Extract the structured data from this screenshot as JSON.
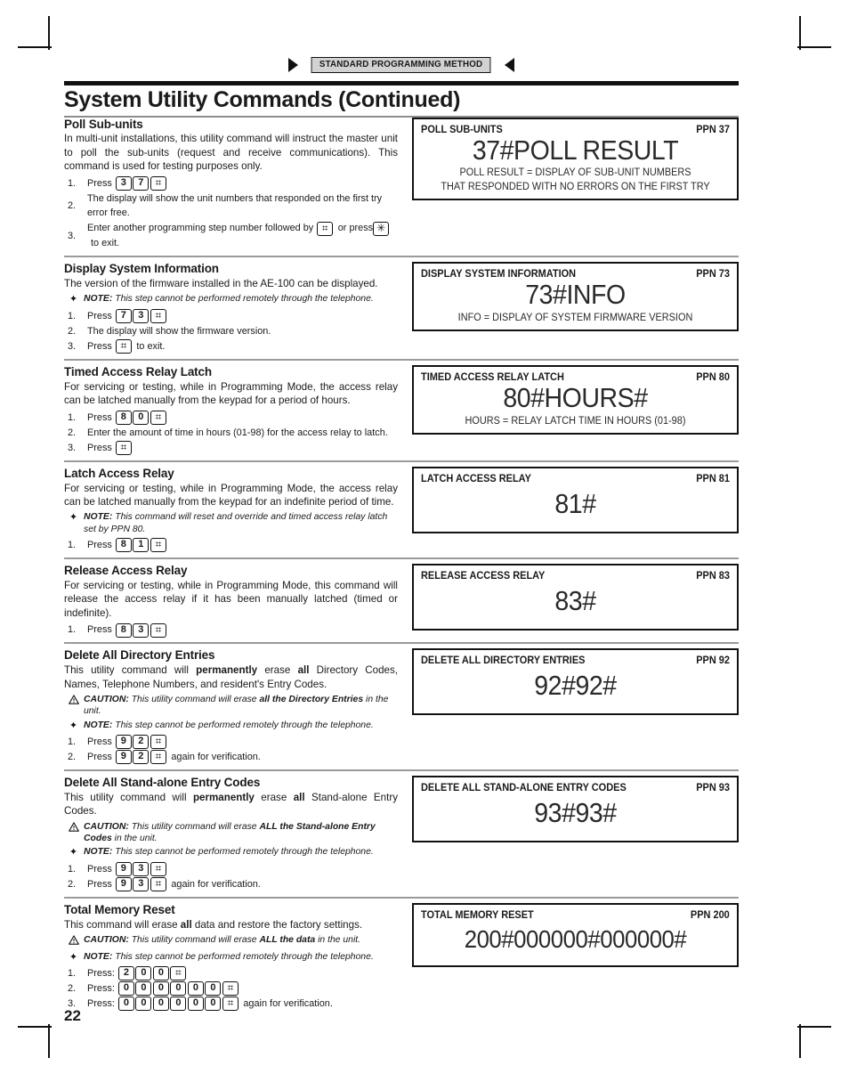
{
  "header": {
    "badge": "STANDARD PROGRAMMING METHOD",
    "arrow_left_icon": "triangle-right-icon",
    "arrow_right_icon": "triangle-left-icon",
    "title": "System Utility Commands (Continued)"
  },
  "page_number": "22",
  "sections": [
    {
      "heading": "Poll Sub-units",
      "body": "In multi-unit installations, this utility command will instruct the master unit to poll the sub-units (request and receive communications). This command is used for testing purposes only.",
      "admonitions": [],
      "steps": [
        {
          "n": "1.",
          "parts": [
            {
              "t": "text",
              "v": "Press"
            },
            {
              "t": "key",
              "v": "3"
            },
            {
              "t": "key",
              "v": "7"
            },
            {
              "t": "key",
              "v": "#"
            }
          ]
        },
        {
          "n": "2.",
          "parts": [
            {
              "t": "text",
              "v": "The display will show the unit numbers that responded on the first try error free."
            }
          ]
        },
        {
          "n": "3.",
          "parts": [
            {
              "t": "text",
              "v": "Enter another programming step number followed by"
            },
            {
              "t": "key",
              "v": "#"
            },
            {
              "t": "text",
              "v": "or press"
            },
            {
              "t": "key",
              "v": "*"
            },
            {
              "t": "text",
              "v": "to exit."
            }
          ]
        }
      ],
      "panel": {
        "title": "POLL SUB-UNITS",
        "ppn": "PPN 37",
        "command": "37#POLL RESULT",
        "captions": [
          "POLL RESULT = DISPLAY OF SUB-UNIT NUMBERS",
          "THAT RESPONDED WITH NO ERRORS ON THE FIRST TRY"
        ]
      }
    },
    {
      "heading": "Display System Information",
      "body": "The version of the firmware installed in the AE-100 can be displayed.",
      "admonitions": [
        {
          "kind": "note",
          "label": "NOTE:",
          "parts": [
            {
              "t": "text",
              "v": "This step cannot be performed remotely through the telephone."
            }
          ]
        }
      ],
      "steps": [
        {
          "n": "1.",
          "parts": [
            {
              "t": "text",
              "v": "Press"
            },
            {
              "t": "key",
              "v": "7"
            },
            {
              "t": "key",
              "v": "3"
            },
            {
              "t": "key",
              "v": "#"
            }
          ]
        },
        {
          "n": "2.",
          "parts": [
            {
              "t": "text",
              "v": "The display will show the firmware version."
            }
          ]
        },
        {
          "n": "3.",
          "parts": [
            {
              "t": "text",
              "v": "Press"
            },
            {
              "t": "key",
              "v": "#"
            },
            {
              "t": "text",
              "v": "to exit."
            }
          ]
        }
      ],
      "panel": {
        "title": "DISPLAY SYSTEM INFORMATION",
        "ppn": "PPN 73",
        "command": "73#INFO",
        "captions": [
          "INFO = DISPLAY OF SYSTEM FIRMWARE VERSION"
        ]
      }
    },
    {
      "heading": "Timed Access Relay Latch",
      "body": "For servicing or testing, while in Programming Mode, the access relay can be latched manually from the keypad for a period of hours.",
      "admonitions": [],
      "steps": [
        {
          "n": "1.",
          "parts": [
            {
              "t": "text",
              "v": "Press"
            },
            {
              "t": "key",
              "v": "8"
            },
            {
              "t": "key",
              "v": "0"
            },
            {
              "t": "key",
              "v": "#"
            }
          ]
        },
        {
          "n": "2.",
          "parts": [
            {
              "t": "text",
              "v": "Enter the amount of time in hours (01-98) for the access relay to latch."
            }
          ]
        },
        {
          "n": "3.",
          "parts": [
            {
              "t": "text",
              "v": "Press"
            },
            {
              "t": "key",
              "v": "#"
            }
          ]
        }
      ],
      "panel": {
        "title": "TIMED ACCESS RELAY LATCH",
        "ppn": "PPN 80",
        "command": "80#HOURS#",
        "captions": [
          "HOURS = RELAY LATCH TIME IN HOURS (01-98)"
        ]
      }
    },
    {
      "heading": "Latch Access Relay",
      "body": "For servicing or testing, while in Programming Mode, the access relay can be latched manually from the keypad for an indefinite period of time.",
      "admonitions": [
        {
          "kind": "note",
          "label": "NOTE:",
          "parts": [
            {
              "t": "text",
              "v": "This command will reset and override and timed access relay latch set by PPN 80."
            }
          ]
        }
      ],
      "steps": [
        {
          "n": "1.",
          "parts": [
            {
              "t": "text",
              "v": "Press"
            },
            {
              "t": "key",
              "v": "8"
            },
            {
              "t": "key",
              "v": "1"
            },
            {
              "t": "key",
              "v": "#"
            }
          ]
        }
      ],
      "panel": {
        "title": "LATCH ACCESS RELAY",
        "ppn": "PPN 81",
        "command": "81#",
        "captions": []
      }
    },
    {
      "heading": "Release Access Relay",
      "body": "For servicing or testing, while in Programming Mode, this command will release the access relay if it has been manually latched (timed or indefinite).",
      "admonitions": [],
      "steps": [
        {
          "n": "1.",
          "parts": [
            {
              "t": "text",
              "v": "Press"
            },
            {
              "t": "key",
              "v": "8"
            },
            {
              "t": "key",
              "v": "3"
            },
            {
              "t": "key",
              "v": "#"
            }
          ]
        }
      ],
      "panel": {
        "title": "RELEASE ACCESS RELAY",
        "ppn": "PPN 83",
        "command": "83#",
        "captions": []
      }
    },
    {
      "heading": "Delete All Directory Entries",
      "body_rich": [
        {
          "t": "text",
          "v": "This utility command will "
        },
        {
          "t": "b",
          "v": "permanently"
        },
        {
          "t": "text",
          "v": " erase "
        },
        {
          "t": "b",
          "v": "all"
        },
        {
          "t": "text",
          "v": " Directory Codes, Names, Telephone Numbers, and resident's Entry Codes."
        }
      ],
      "admonitions": [
        {
          "kind": "caution",
          "label": "CAUTION:",
          "parts": [
            {
              "t": "text",
              "v": "This utility command will erase "
            },
            {
              "t": "b",
              "v": "all the Directory Entries"
            },
            {
              "t": "text",
              "v": " in the unit."
            }
          ]
        },
        {
          "kind": "note",
          "label": "NOTE:",
          "parts": [
            {
              "t": "text",
              "v": "This step cannot be performed remotely through the telephone."
            }
          ]
        }
      ],
      "steps": [
        {
          "n": "1.",
          "parts": [
            {
              "t": "text",
              "v": "Press"
            },
            {
              "t": "key",
              "v": "9"
            },
            {
              "t": "key",
              "v": "2"
            },
            {
              "t": "key",
              "v": "#"
            }
          ]
        },
        {
          "n": "2.",
          "parts": [
            {
              "t": "text",
              "v": "Press"
            },
            {
              "t": "key",
              "v": "9"
            },
            {
              "t": "key",
              "v": "2"
            },
            {
              "t": "key",
              "v": "#"
            },
            {
              "t": "text",
              "v": "again for verification."
            }
          ]
        }
      ],
      "panel": {
        "title": "DELETE ALL DIRECTORY ENTRIES",
        "ppn": "PPN 92",
        "command": "92#92#",
        "captions": []
      }
    },
    {
      "heading": "Delete All Stand-alone Entry Codes",
      "body_rich": [
        {
          "t": "text",
          "v": "This utility command will "
        },
        {
          "t": "b",
          "v": "permanently"
        },
        {
          "t": "text",
          "v": " erase "
        },
        {
          "t": "b",
          "v": "all"
        },
        {
          "t": "text",
          "v": " Stand-alone Entry Codes."
        }
      ],
      "admonitions": [
        {
          "kind": "caution",
          "label": "CAUTION:",
          "parts": [
            {
              "t": "text",
              "v": "This utility command will erase "
            },
            {
              "t": "b",
              "v": "ALL the Stand-alone Entry Codes"
            },
            {
              "t": "text",
              "v": " in the unit."
            }
          ]
        },
        {
          "kind": "note",
          "label": "NOTE:",
          "parts": [
            {
              "t": "text",
              "v": "This step cannot be performed remotely through the telephone."
            }
          ]
        }
      ],
      "steps": [
        {
          "n": "1.",
          "parts": [
            {
              "t": "text",
              "v": "Press"
            },
            {
              "t": "key",
              "v": "9"
            },
            {
              "t": "key",
              "v": "3"
            },
            {
              "t": "key",
              "v": "#"
            }
          ]
        },
        {
          "n": "2.",
          "parts": [
            {
              "t": "text",
              "v": "Press"
            },
            {
              "t": "key",
              "v": "9"
            },
            {
              "t": "key",
              "v": "3"
            },
            {
              "t": "key",
              "v": "#"
            },
            {
              "t": "text",
              "v": "again for verification."
            }
          ]
        }
      ],
      "panel": {
        "title": "DELETE ALL STAND-ALONE ENTRY CODES",
        "ppn": "PPN 93",
        "command": "93#93#",
        "captions": []
      }
    },
    {
      "heading": "Total Memory Reset",
      "body_rich": [
        {
          "t": "text",
          "v": "This command will erase "
        },
        {
          "t": "b",
          "v": "all"
        },
        {
          "t": "text",
          "v": " data and restore the factory settings."
        }
      ],
      "admonitions": [
        {
          "kind": "caution",
          "label": "CAUTION:",
          "parts": [
            {
              "t": "text",
              "v": "This utility command will erase "
            },
            {
              "t": "b",
              "v": "ALL the data"
            },
            {
              "t": "text",
              "v": " in the unit."
            }
          ]
        },
        {
          "kind": "note",
          "label": "NOTE:",
          "parts": [
            {
              "t": "text",
              "v": "This step cannot be performed remotely through the telephone."
            }
          ]
        }
      ],
      "steps": [
        {
          "n": "1.",
          "parts": [
            {
              "t": "text",
              "v": "Press:"
            },
            {
              "t": "key",
              "v": "2"
            },
            {
              "t": "key",
              "v": "0"
            },
            {
              "t": "key",
              "v": "0"
            },
            {
              "t": "key",
              "v": "#"
            }
          ]
        },
        {
          "n": "2.",
          "parts": [
            {
              "t": "text",
              "v": "Press:"
            },
            {
              "t": "key",
              "v": "0"
            },
            {
              "t": "key",
              "v": "0"
            },
            {
              "t": "key",
              "v": "0"
            },
            {
              "t": "key",
              "v": "0"
            },
            {
              "t": "key",
              "v": "0"
            },
            {
              "t": "key",
              "v": "0"
            },
            {
              "t": "key",
              "v": "#"
            }
          ]
        },
        {
          "n": "3.",
          "parts": [
            {
              "t": "text",
              "v": "Press:"
            },
            {
              "t": "key",
              "v": "0"
            },
            {
              "t": "key",
              "v": "0"
            },
            {
              "t": "key",
              "v": "0"
            },
            {
              "t": "key",
              "v": "0"
            },
            {
              "t": "key",
              "v": "0"
            },
            {
              "t": "key",
              "v": "0"
            },
            {
              "t": "key",
              "v": "#"
            },
            {
              "t": "text",
              "v": "again for verification."
            }
          ]
        }
      ],
      "panel": {
        "title": "TOTAL MEMORY RESET",
        "ppn": "PPN 200",
        "command": "200#000000#000000#",
        "captions": []
      }
    }
  ]
}
